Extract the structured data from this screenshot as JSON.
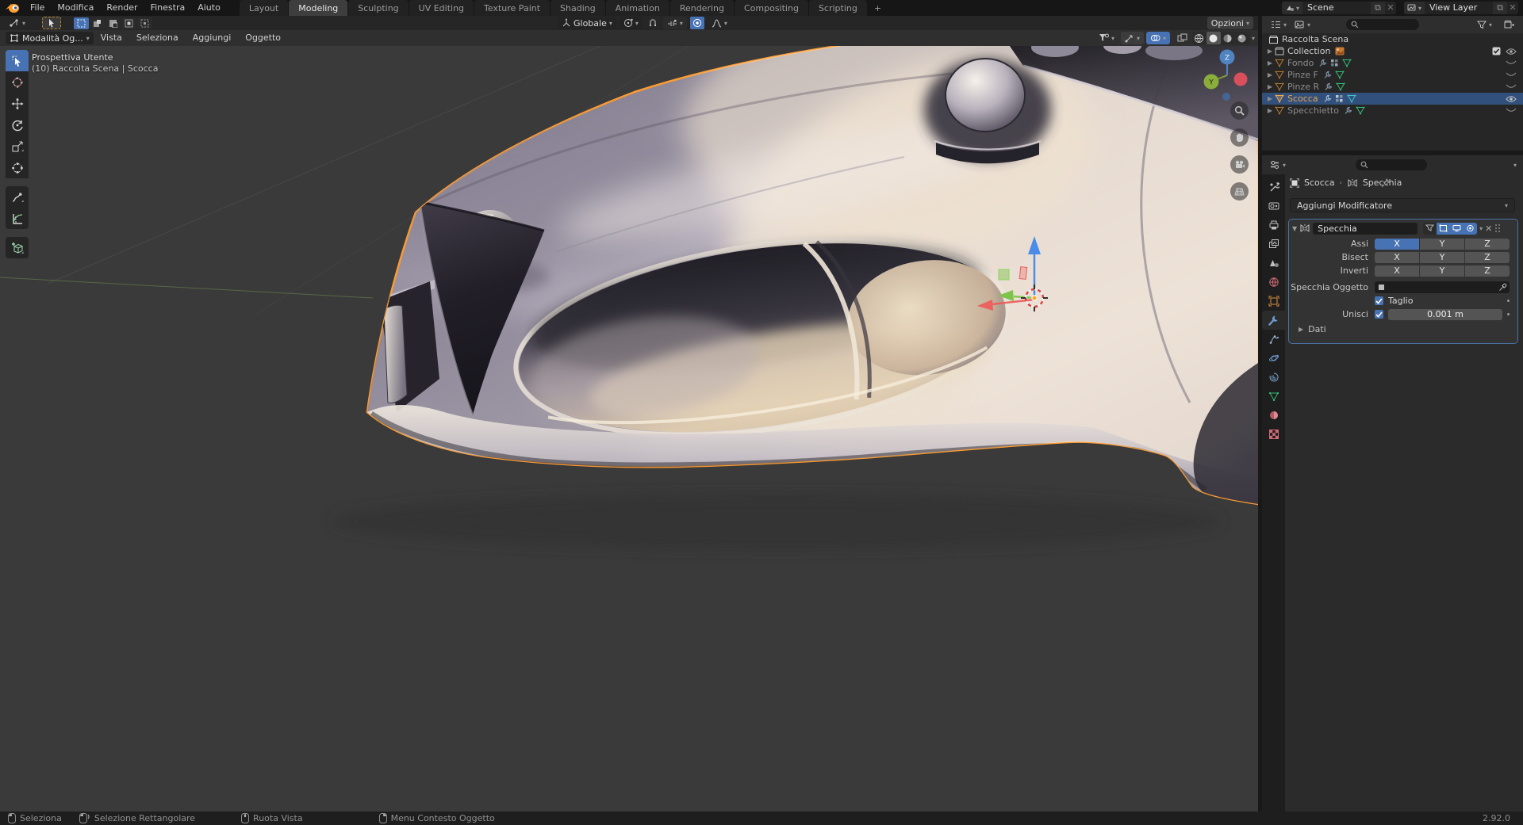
{
  "topbar": {
    "menus": [
      "File",
      "Modifica",
      "Render",
      "Finestra",
      "Aiuto"
    ],
    "tabs": [
      "Layout",
      "Modeling",
      "Sculpting",
      "UV Editing",
      "Texture Paint",
      "Shading",
      "Animation",
      "Rendering",
      "Compositing",
      "Scripting"
    ],
    "new_tab_label": "+",
    "active_tab": "Modeling",
    "scene_name": "Scene",
    "view_layer_name": "View Layer"
  },
  "tool_settings": {
    "orientation_label": "Globale",
    "options_label": "Opzioni"
  },
  "viewport_header": {
    "mode_label": "Modalità Og...",
    "menus": [
      "Vista",
      "Seleziona",
      "Aggiungi",
      "Oggetto"
    ]
  },
  "viewport": {
    "view_label": "Prospettiva Utente",
    "context_label": "(10) Raccolta Scena | Scocca",
    "axis_z": "Z",
    "axis_y": "Y"
  },
  "outliner": {
    "items": [
      {
        "label": "Raccolta Scena"
      },
      {
        "label": "Collection"
      },
      {
        "label": "Fondo"
      },
      {
        "label": "Pinze F"
      },
      {
        "label": "Pinze R"
      },
      {
        "label": "Scocca"
      },
      {
        "label": "Specchietto"
      }
    ]
  },
  "properties": {
    "breadcrumb_object": "Scocca",
    "breadcrumb_modifier": "Specchia",
    "add_modifier_label": "Aggiungi Modificatore",
    "modifier": {
      "name": "Specchia",
      "axis_label": "Assi",
      "bisect_label": "Bisect",
      "flip_label": "Inverti",
      "x": "X",
      "y": "Y",
      "z": "Z",
      "mirror_object_label": "Specchia Oggetto",
      "clipping_label": "Taglio",
      "merge_label": "Unisci",
      "merge_value": "0.001 m",
      "data_label": "Dati"
    }
  },
  "status_bar": {
    "select_label": "Seleziona",
    "box_select_label": "Selezione Rettangolare",
    "rotate_view_label": "Ruota Vista",
    "context_menu_label": "Menu Contesto Oggetto",
    "version": "2.92.0"
  },
  "colors": {
    "accent": "#4772b3",
    "selection_outline": "#fb9b33",
    "selected_row": "#31517c",
    "object_orange": "#e0933f",
    "mesh_green": "#35bb77",
    "mesh_teal": "#3fc1c9"
  }
}
